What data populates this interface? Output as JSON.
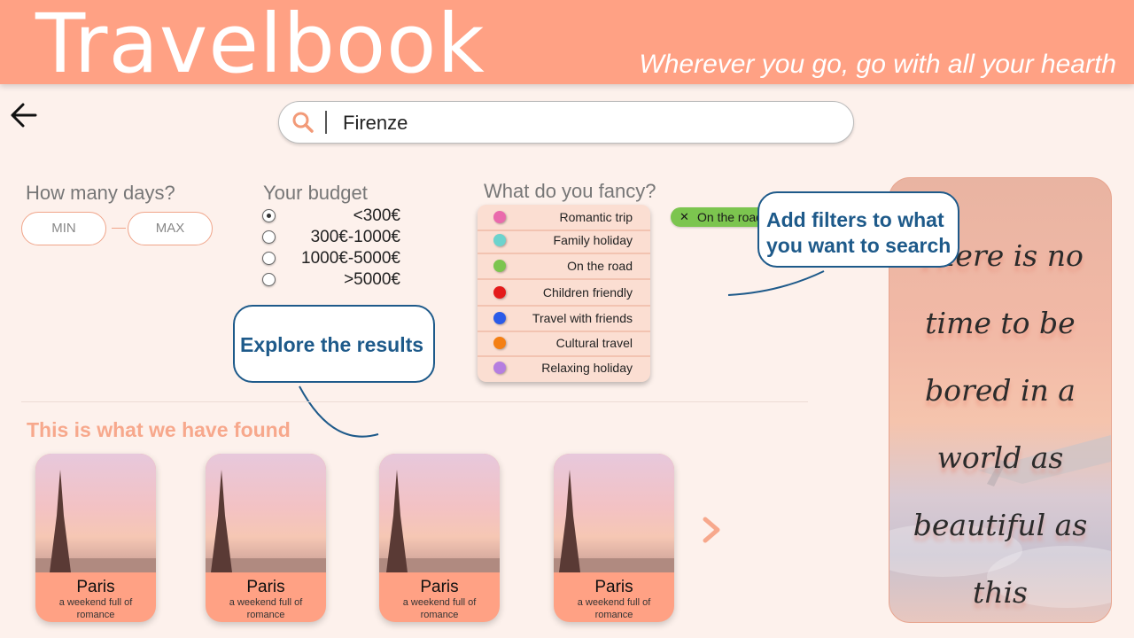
{
  "header": {
    "title": "Travelbook",
    "tagline": "Wherever you go, go with all your hearth"
  },
  "search": {
    "value": "Firenze"
  },
  "days": {
    "label": "How many days?",
    "min_label": "MIN",
    "max_label": "MAX"
  },
  "budget": {
    "label": "Your budget",
    "options": [
      "<300€",
      "300€-1000€",
      "1000€-5000€",
      ">5000€"
    ],
    "selected": "<300€"
  },
  "fancy": {
    "label": "What do you fancy?",
    "items": [
      {
        "label": "Romantic trip",
        "color": "#ea6aac"
      },
      {
        "label": "Family holiday",
        "color": "#6dd3cd"
      },
      {
        "label": "On the road",
        "color": "#7cc54f"
      },
      {
        "label": "Children friendly",
        "color": "#e41b1b"
      },
      {
        "label": "Travel with friends",
        "color": "#2b5be8"
      },
      {
        "label": "Cultural travel",
        "color": "#f47f14"
      },
      {
        "label": "Relaxing holiday",
        "color": "#b57ee0"
      }
    ]
  },
  "active_filter": {
    "label": "On the road"
  },
  "callouts": {
    "filters": "Add filters to what you want to search",
    "explore": "Explore the results"
  },
  "results": {
    "title": "This is what we have found",
    "cards": [
      {
        "name": "Paris",
        "subtitle": "a weekend full of romance"
      },
      {
        "name": "Paris",
        "subtitle": "a weekend full of romance"
      },
      {
        "name": "Paris",
        "subtitle": "a weekend full of romance"
      },
      {
        "name": "Paris",
        "subtitle": "a weekend full of romance"
      }
    ]
  },
  "quote": {
    "text": "There is no time to be bored in a world as beautiful as this"
  },
  "colors": {
    "accent": "#ffa184",
    "background": "#fdf1ec",
    "callout": "#1e5a8a"
  }
}
